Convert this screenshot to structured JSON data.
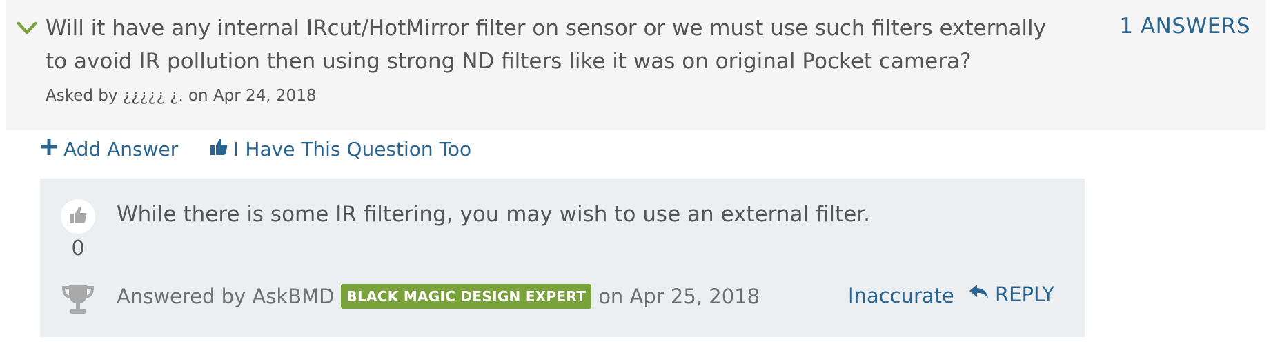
{
  "question": {
    "text": "Will it have any internal IRcut/HotMirror filter on sensor or we must use such filters externally to avoid IR pollution then using strong ND filters like it was on original Pocket camera?",
    "asked_by": "Asked by ¿¿¿¿¿ ¿. on Apr 24, 2018",
    "answers_count": "1 ANSWERS"
  },
  "actions": {
    "add_answer": "Add Answer",
    "have_question": "I Have This Question Too"
  },
  "answer": {
    "text": "While there is some IR filtering, you may wish to use an external filter.",
    "votes": "0",
    "answered_by": "Answered by AskBMD",
    "badge": "BLACK MAGIC DESIGN EXPERT",
    "answered_on": "on Apr 25, 2018",
    "inaccurate": "Inaccurate",
    "reply": "REPLY"
  },
  "colors": {
    "link": "#2a6592",
    "badge": "#7aa23a",
    "chevron": "#7aa23a",
    "question_bg": "#f5f5f5",
    "answer_bg": "#eceff2"
  },
  "icons": [
    "chevron-down-icon",
    "plus-icon",
    "thumbs-up-icon",
    "trophy-icon",
    "reply-icon"
  ]
}
